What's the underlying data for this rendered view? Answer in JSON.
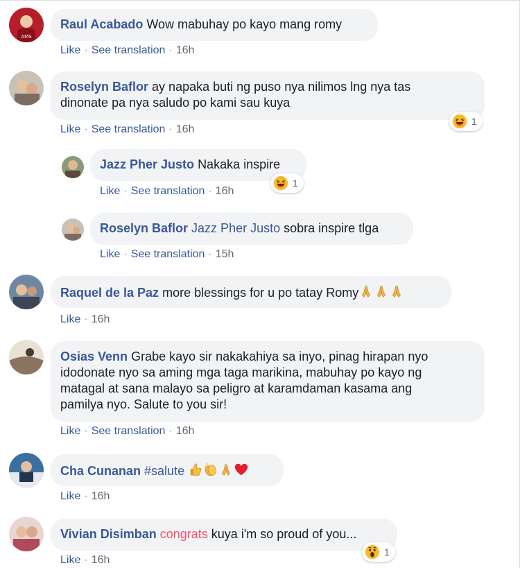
{
  "actions": {
    "like": "Like",
    "see_translation": "See translation",
    "separator": "·"
  },
  "comments": [
    {
      "author": "Raul Acabado",
      "text": "Wow mabuhay po kayo mang romy",
      "time": "16h"
    },
    {
      "author": "Roselyn Baflor",
      "text_line1": "ay napaka buti ng puso nya nilimos lng nya tas",
      "text_line2": "dinonate pa nya saludo po kami sau kuya",
      "time": "16h",
      "reaction": {
        "icon": "haha-wow-icon",
        "count": "1"
      }
    },
    {
      "author": "Jazz Pher Justo",
      "text": "Nakaka inspire",
      "time": "16h",
      "reaction": {
        "icon": "haha-wow-icon",
        "count": "1"
      }
    },
    {
      "author": "Roselyn Baflor",
      "mention": "Jazz Pher Justo",
      "text": "sobra inspire tlga",
      "time": "15h"
    },
    {
      "author": "Raquel de la Paz",
      "text": "more blessings for u po tatay Romy",
      "emojis": [
        "folded-hands-emoji",
        "folded-hands-emoji",
        "folded-hands-emoji"
      ],
      "time": "16h"
    },
    {
      "author": "Osias Venn",
      "text_line1": "Grabe kayo sir nakakahiya sa inyo, pinag hirapan nyo",
      "text_line2": "idodonate nyo sa aming mga taga marikina, mabuhay po kayo ng",
      "text_line3": "matagal at sana malayo sa peligro at karamdaman kasama ang",
      "text_line4": "pamilya nyo. Salute to you sir!",
      "time": "16h"
    },
    {
      "author": "Cha Cunanan",
      "hashtag": "#salute",
      "emojis": [
        "thumbs-up-emoji",
        "clapping-hands-emoji",
        "folded-hands-emoji",
        "red-heart-emoji"
      ],
      "time": "16h"
    },
    {
      "author": "Vivian Disimban",
      "highlight": "congrats",
      "text": "kuya i'm so proud of you...",
      "time": "16h",
      "reaction": {
        "icon": "wow-icon",
        "count": "1"
      }
    }
  ]
}
